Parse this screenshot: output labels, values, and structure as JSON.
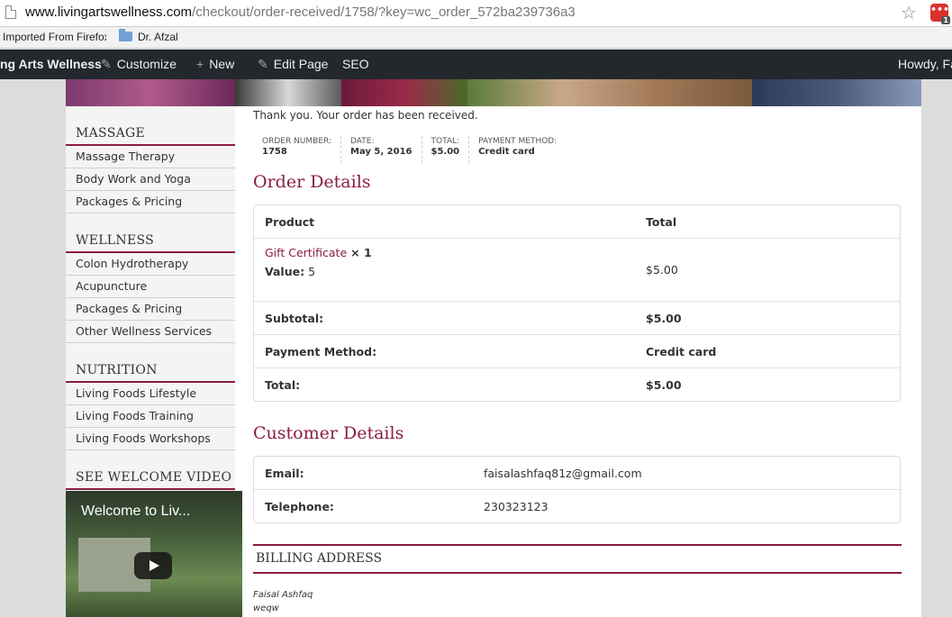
{
  "browser": {
    "url_host": "www.livingartswellness.com",
    "url_path": "/checkout/order-received/1758/?key=wc_order_572ba239736a3",
    "extension_badge": "1",
    "bookmarks": [
      "Imported From Firefox",
      "Dr. Afzal"
    ]
  },
  "adminbar": {
    "site": "ng Arts Wellness",
    "customize": "Customize",
    "new": "New",
    "edit_page": "Edit Page",
    "seo": "SEO",
    "howdy": "Howdy, Fa"
  },
  "sidebar": {
    "sections": [
      {
        "title": "MASSAGE",
        "links": [
          "Massage Therapy",
          "Body Work and Yoga",
          "Packages & Pricing"
        ]
      },
      {
        "title": "WELLNESS",
        "links": [
          "Colon Hydrotherapy",
          "Acupuncture",
          "Packages & Pricing",
          "Other Wellness Services"
        ]
      },
      {
        "title": "NUTRITION",
        "links": [
          "Living Foods Lifestyle",
          "Living Foods Training",
          "Living Foods Workshops"
        ]
      }
    ],
    "video_heading": "SEE WELCOME VIDEO",
    "video_title": "Welcome to Liv..."
  },
  "main": {
    "thanks": "Thank you. Your order has been received.",
    "overview": [
      {
        "label": "ORDER NUMBER:",
        "value": "1758"
      },
      {
        "label": "DATE:",
        "value": "May 5, 2016"
      },
      {
        "label": "TOTAL:",
        "value": "$5.00"
      },
      {
        "label": "PAYMENT METHOD:",
        "value": "Credit card"
      }
    ],
    "order_details_title": "Order Details",
    "order_table": {
      "head_product": "Product",
      "head_total": "Total",
      "item_name": "Gift Certificate",
      "item_qty": "× 1",
      "item_meta_label": "Value:",
      "item_meta_value": "5",
      "item_total": "$5.00",
      "subtotal_label": "Subtotal:",
      "subtotal_value": "$5.00",
      "payment_label": "Payment Method:",
      "payment_value": "Credit card",
      "total_label": "Total:",
      "total_value": "$5.00"
    },
    "customer_details_title": "Customer Details",
    "customer": {
      "email_label": "Email:",
      "email": "faisalashfaq81z@gmail.com",
      "phone_label": "Telephone:",
      "phone": "230323123"
    },
    "billing_title": "BILLING ADDRESS",
    "billing_lines": [
      "Faisal Ashfaq",
      "weqw"
    ]
  },
  "colors": {
    "accent": "#8a1e3e",
    "adminbar": "#23282d"
  }
}
